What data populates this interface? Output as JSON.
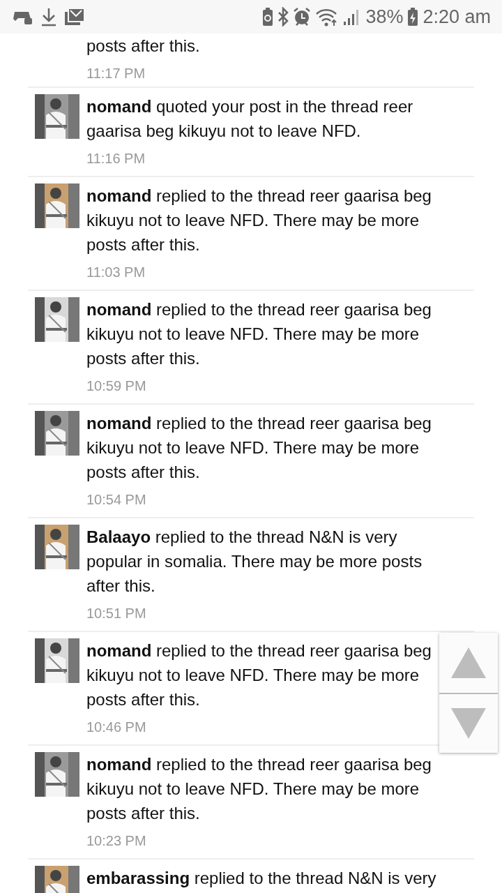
{
  "status_bar": {
    "battery_percent": "38%",
    "time": "2:20 am"
  },
  "alerts": [
    {
      "message": "posts after this.",
      "time": "11:17 PM",
      "kind": "continuation"
    },
    {
      "message": "**nomand** quoted your post in the thread reer gaarisa beg kikuyu not to leave NFD.",
      "time": "11:16 PM"
    },
    {
      "message": "**nomand** replied to the thread reer gaarisa beg kikuyu not to leave NFD. There may be more posts after this.",
      "time": "11:03 PM"
    },
    {
      "message": "**nomand** replied to the thread reer gaarisa beg kikuyu not to leave NFD. There may be more posts after this.",
      "time": "10:59 PM"
    },
    {
      "message": "**nomand** replied to the thread reer gaarisa beg kikuyu not to leave NFD. There may be more posts after this.",
      "time": "10:54 PM"
    },
    {
      "message": "**Balaayo** replied to the thread N&N is very popular in somalia. There may be more posts after this.",
      "time": "10:51 PM"
    },
    {
      "message": "**nomand** replied to the thread reer gaarisa beg kikuyu not to leave NFD. There may be more posts after this.",
      "time": "10:46 PM"
    },
    {
      "message": "**nomand** replied to the thread reer gaarisa beg kikuyu not to leave NFD. There may be more posts after this.",
      "time": "10:23 PM"
    },
    {
      "message": "**embarassing** replied to the thread N&N is very"
    }
  ]
}
